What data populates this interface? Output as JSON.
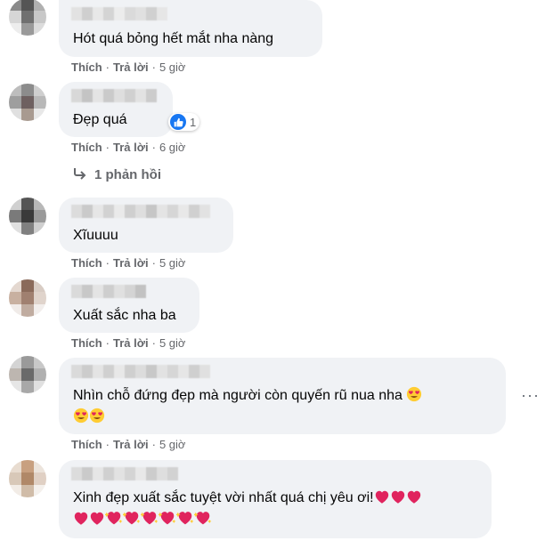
{
  "comments": [
    {
      "text": "Hót quá bỏng hết mắt nha nàng",
      "like": "Thích",
      "reply": "Trả lời",
      "time": "5 giờ"
    },
    {
      "text": "Đẹp quá",
      "like": "Thích",
      "reply": "Trả lời",
      "time": "6 giờ",
      "reaction_count": "1",
      "replies_label": "1 phản hồi"
    },
    {
      "text": "Xĩuuuu",
      "like": "Thích",
      "reply": "Trả lời",
      "time": "5 giờ"
    },
    {
      "text": "Xuất sắc nha ba",
      "like": "Thích",
      "reply": "Trả lời",
      "time": "5 giờ"
    },
    {
      "text": "Nhìn chỗ đứng đẹp mà người còn quyến rũ nua nha",
      "like": "Thích",
      "reply": "Trả lời",
      "time": "5 giờ",
      "more": "···"
    },
    {
      "text": "Xinh đẹp xuất sắc tuyệt vời nhất quá chị yêu ơi!"
    }
  ],
  "icons": {
    "like_badge": "thumbs-up-icon",
    "reply_arrow": "reply-arrow-icon",
    "heart_eyes": "heart-eyes-emoji",
    "heart": "red-heart-emoji",
    "sparkle_heart": "sparkling-heart-emoji"
  },
  "colors": {
    "bubble": "#f0f2f5",
    "meta": "#65676b",
    "like_blue": "#1877f2",
    "heart": "#e0245e"
  }
}
